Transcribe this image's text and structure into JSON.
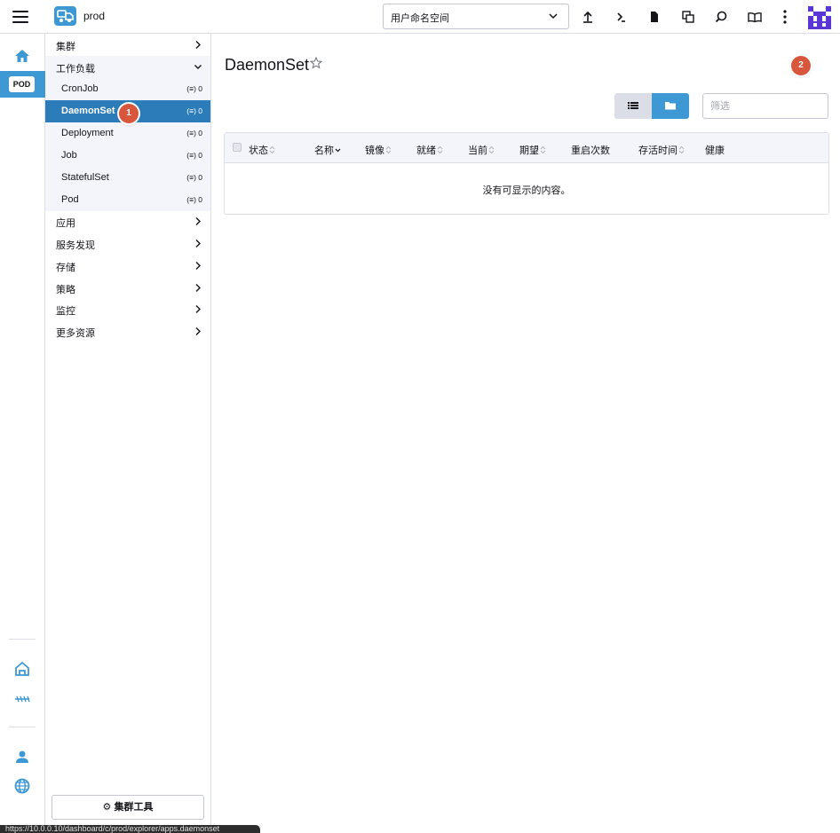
{
  "header": {
    "cluster_name": "prod",
    "namespace_select": "用户命名空间",
    "icons": [
      "upload-icon",
      "terminal-icon",
      "file-icon",
      "copy-kubeconfig-icon",
      "search-icon",
      "docs-book-icon",
      "more-vertical-icon"
    ]
  },
  "rail": {
    "active_cluster_badge": "POD"
  },
  "sidenav": {
    "groups": [
      {
        "label": "集群"
      },
      {
        "label": "工作负载"
      },
      {
        "label": "应用"
      },
      {
        "label": "服务发现"
      },
      {
        "label": "存储"
      },
      {
        "label": "策略"
      },
      {
        "label": "监控"
      },
      {
        "label": "更多资源"
      }
    ],
    "workload_items": [
      {
        "label": "CronJob",
        "count": "0"
      },
      {
        "label": "DaemonSet",
        "count": "0"
      },
      {
        "label": "Deployment",
        "count": "0"
      },
      {
        "label": "Job",
        "count": "0"
      },
      {
        "label": "StatefulSet",
        "count": "0"
      },
      {
        "label": "Pod",
        "count": "0"
      }
    ],
    "cluster_tools": "集群工具"
  },
  "main": {
    "title": "DaemonSet",
    "filter_placeholder": "筛选",
    "columns": [
      "状态",
      "名称",
      "镜像",
      "就绪",
      "当前",
      "期望",
      "重启次数",
      "存活时间",
      "健康"
    ],
    "empty_message": "没有可显示的内容。"
  },
  "markers": [
    "1",
    "2"
  ],
  "statusbar": "https://10.0.0.10/dashboard/c/prod/explorer/apps.daemonset",
  "colors": {
    "accent": "#3d98d3",
    "active_nav": "#2b7cb8",
    "marker": "#d8573c"
  }
}
